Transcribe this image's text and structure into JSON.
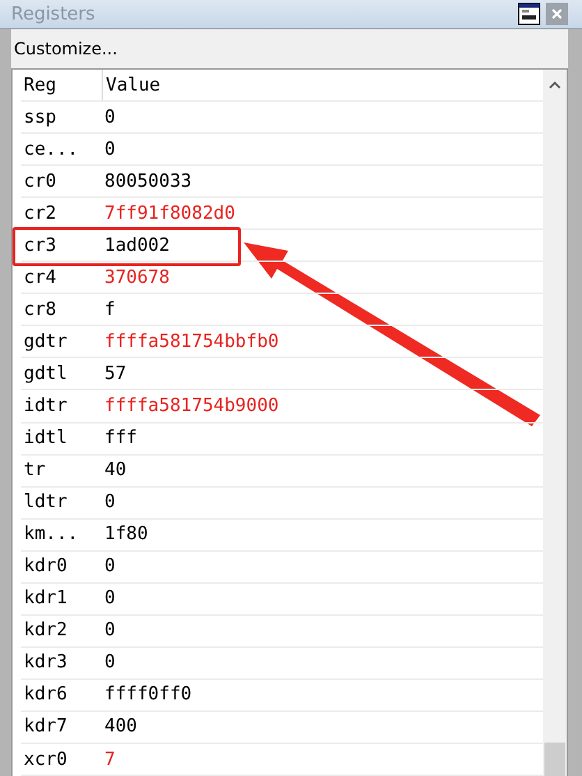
{
  "window": {
    "title": "Registers"
  },
  "toolbar": {
    "customize": "Customize..."
  },
  "table": {
    "columns": [
      "Reg",
      "Value"
    ],
    "rows": [
      {
        "reg": "ssp",
        "value": "0",
        "changed": false,
        "highlighted": false
      },
      {
        "reg": "ce...",
        "value": "0",
        "changed": false,
        "highlighted": false
      },
      {
        "reg": "cr0",
        "value": "80050033",
        "changed": false,
        "highlighted": false
      },
      {
        "reg": "cr2",
        "value": "7ff91f8082d0",
        "changed": true,
        "highlighted": false
      },
      {
        "reg": "cr3",
        "value": "1ad002",
        "changed": false,
        "highlighted": true
      },
      {
        "reg": "cr4",
        "value": "370678",
        "changed": true,
        "highlighted": false
      },
      {
        "reg": "cr8",
        "value": "f",
        "changed": false,
        "highlighted": false
      },
      {
        "reg": "gdtr",
        "value": "ffffa581754bbfb0",
        "changed": true,
        "highlighted": false
      },
      {
        "reg": "gdtl",
        "value": "57",
        "changed": false,
        "highlighted": false
      },
      {
        "reg": "idtr",
        "value": "ffffa581754b9000",
        "changed": true,
        "highlighted": false
      },
      {
        "reg": "idtl",
        "value": "fff",
        "changed": false,
        "highlighted": false
      },
      {
        "reg": "tr",
        "value": "40",
        "changed": false,
        "highlighted": false
      },
      {
        "reg": "ldtr",
        "value": "0",
        "changed": false,
        "highlighted": false
      },
      {
        "reg": "km...",
        "value": "1f80",
        "changed": false,
        "highlighted": false
      },
      {
        "reg": "kdr0",
        "value": "0",
        "changed": false,
        "highlighted": false
      },
      {
        "reg": "kdr1",
        "value": "0",
        "changed": false,
        "highlighted": false
      },
      {
        "reg": "kdr2",
        "value": "0",
        "changed": false,
        "highlighted": false
      },
      {
        "reg": "kdr3",
        "value": "0",
        "changed": false,
        "highlighted": false
      },
      {
        "reg": "kdr6",
        "value": "ffff0ff0",
        "changed": false,
        "highlighted": false
      },
      {
        "reg": "kdr7",
        "value": "400",
        "changed": false,
        "highlighted": false
      },
      {
        "reg": "xcr0",
        "value": "7",
        "changed": true,
        "highlighted": false
      }
    ]
  }
}
